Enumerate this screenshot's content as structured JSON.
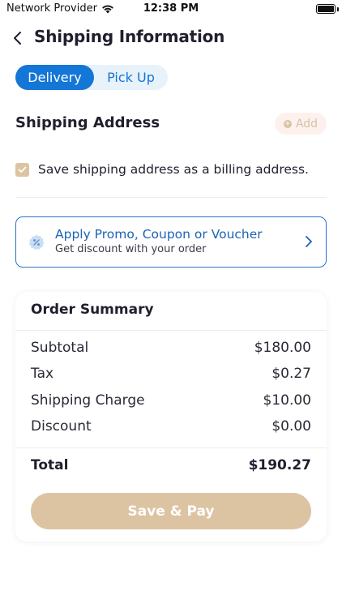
{
  "status_bar": {
    "carrier": "Network Provider",
    "time": "12:38 PM"
  },
  "header": {
    "title": "Shipping Information"
  },
  "tabs": [
    {
      "label": "Delivery",
      "active": true
    },
    {
      "label": "Pick Up",
      "active": false
    }
  ],
  "shipping_address": {
    "heading": "Shipping Address",
    "add_label": "Add",
    "billing_checkbox_label": "Save shipping address as a billing address.",
    "billing_checked": true
  },
  "promo": {
    "title": "Apply Promo, Coupon or Voucher",
    "subtitle": "Get discount with your order"
  },
  "order_summary": {
    "title": "Order Summary",
    "rows": [
      {
        "label": "Subtotal",
        "value": "$180.00"
      },
      {
        "label": "Tax",
        "value": "$0.27"
      },
      {
        "label": "Shipping Charge",
        "value": "$10.00"
      },
      {
        "label": "Discount",
        "value": "$0.00"
      }
    ],
    "total_label": "Total",
    "total_value": "$190.27",
    "pay_button": "Save & Pay"
  },
  "colors": {
    "accent_blue": "#1476d6",
    "beige": "#dcc4a3",
    "text_dark": "#1f1f2e"
  }
}
